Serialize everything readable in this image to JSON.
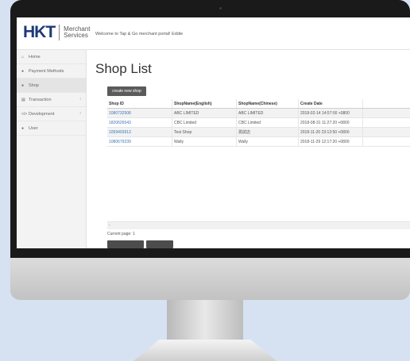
{
  "header": {
    "logo_mark": "HKT",
    "logo_line1": "Merchant",
    "logo_line2": "Services",
    "welcome": "Welcome to Tap & Go merchant portal! Eddie"
  },
  "sidebar": {
    "items": [
      {
        "label": "Home",
        "icon": "home-icon",
        "glyph": "⌂"
      },
      {
        "label": "Payment Methods",
        "icon": "payment-icon",
        "glyph": "●"
      },
      {
        "label": "Shop",
        "icon": "shop-icon",
        "glyph": "●"
      },
      {
        "label": "Transaction",
        "icon": "transaction-icon",
        "glyph": "▤"
      },
      {
        "label": "Development",
        "icon": "development-icon",
        "glyph": "</>"
      },
      {
        "label": "User",
        "icon": "user-icon",
        "glyph": "●"
      }
    ],
    "chevron": "‹"
  },
  "main": {
    "title": "Shop List",
    "create_button": "create new shop",
    "columns": [
      "Shop ID",
      "ShopName(English)",
      "ShopName(Chinese)",
      "Create Date"
    ],
    "rows": [
      {
        "id": "1080732508",
        "name_en": "ABC LIMITED",
        "name_zh": "ABC LIMITED",
        "date": "2018-02-14 14:57:00 +0800"
      },
      {
        "id": "1820626543",
        "name_en": "CBC Limited",
        "name_zh": "CBC Limited",
        "date": "2018-08-31 11:27:20 +0800"
      },
      {
        "id": "1059403913",
        "name_en": "Test Shop",
        "name_zh": "測試店",
        "date": "2018-11-20 23:12:50 +0800"
      },
      {
        "id": "1080679239",
        "name_en": "Wally",
        "name_zh": "Wally",
        "date": "2018-11-29 12:17:20 +0800"
      }
    ],
    "scroll_arrow": "‹",
    "current_page": "Current page: 1"
  }
}
